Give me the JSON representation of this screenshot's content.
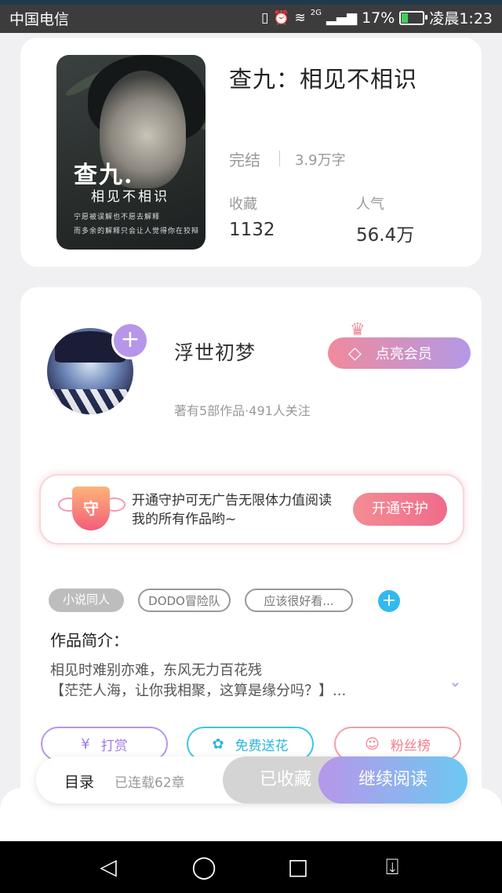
{
  "status_bar": {
    "carrier": "中国电信",
    "network_type": "2G",
    "battery_percent": "17%",
    "time": "凌晨1:23",
    "icons": [
      "vibrate-icon",
      "alarm-icon",
      "wifi-icon",
      "signal-icon",
      "battery-icon"
    ]
  },
  "book": {
    "title": "查九：相见不相识",
    "status": "完结",
    "word_count": "3.9万字",
    "favorites_label": "收藏",
    "favorites_value": "1132",
    "popularity_label": "人气",
    "popularity_value": "56.4万",
    "cover": {
      "title_line1": "查九.",
      "title_line2": "相见不相识",
      "caption_line1": "宁愿被误解也不愿去解释",
      "caption_line2": "而多余的解释只会让人觉得你在狡辩"
    }
  },
  "author": {
    "name": "浮世初梦",
    "meta": "著有5部作品·491人关注",
    "vip_button": "点亮会员",
    "follow_icon": "plus-icon"
  },
  "guard": {
    "badge": "守",
    "text": "开通守护可无广告无限体力值阅读我的所有作品哟~",
    "button": "开通守护"
  },
  "tags": [
    "小说同人",
    "DODO冒险队",
    "应该很好看..."
  ],
  "intro": {
    "title": "作品简介：",
    "line1": "相见时难别亦难，东风无力百花残",
    "line2": "【茫茫人海，让你我相聚，这算是缘分吗？】..."
  },
  "actions": {
    "tip": "打赏",
    "flower": "免费送花",
    "fans": "粉丝榜"
  },
  "bottom": {
    "toc": "目录",
    "serial": "已连载62章",
    "collected": "已收藏",
    "read": "继续阅读"
  },
  "colors": {
    "accent_purple": "#b696ea",
    "accent_pink": "#f06b8c",
    "accent_blue": "#32b9f0"
  }
}
